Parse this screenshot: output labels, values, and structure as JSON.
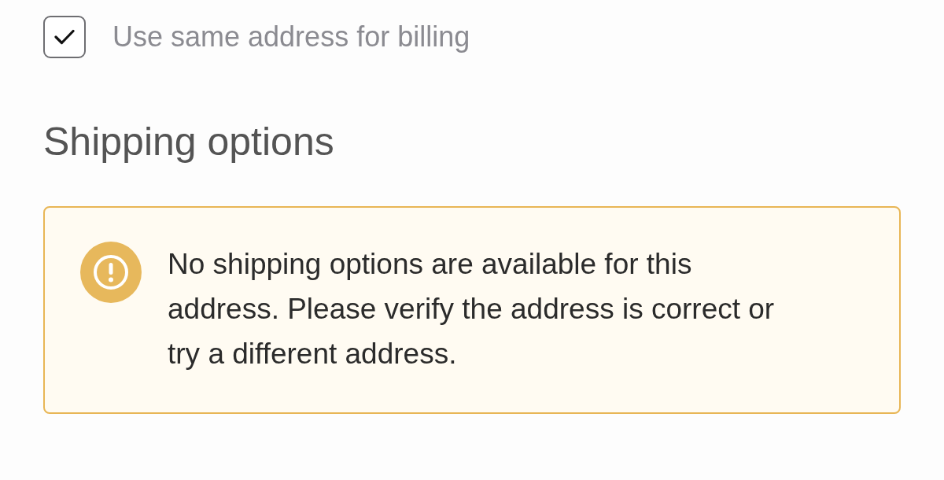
{
  "billing_checkbox": {
    "label": "Use same address for billing",
    "checked": true
  },
  "shipping": {
    "heading": "Shipping options",
    "alert": {
      "kind": "warning",
      "message": "No shipping options are available for this address. Please verify the address is correct or try a different address."
    }
  }
}
